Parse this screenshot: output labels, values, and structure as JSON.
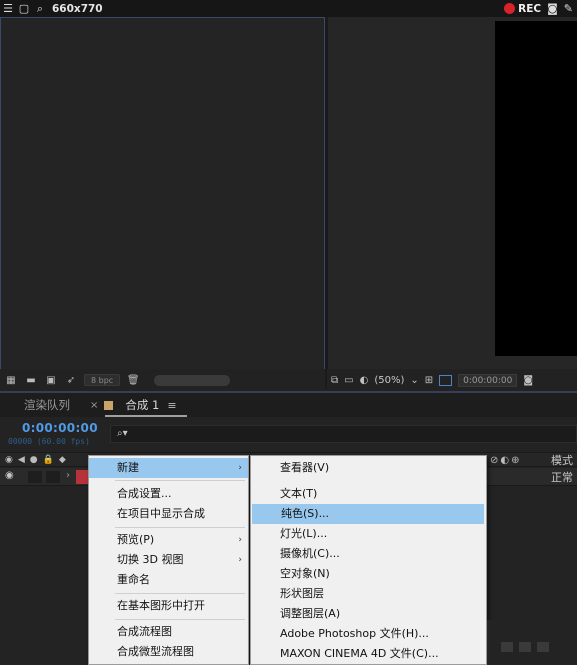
{
  "recorder": {
    "size_label": "660x770",
    "rec_label": "REC"
  },
  "viewer_left": {
    "bpc_label": "8 bpc"
  },
  "viewer_right": {
    "zoom_label": "(50%)",
    "timecode": "0:00:00:00"
  },
  "timeline": {
    "tab_render_queue": "渲染队列",
    "tab_close": "×",
    "tab_comp": "合成 1",
    "tab_menu": "≡",
    "timecode": "0:00:00:00",
    "fps_label": "00000 (60.00 fps)",
    "search_icon_glyph": "⌕▾",
    "header_mode": "模式",
    "layer_mode": "正常"
  },
  "context_menu": {
    "items": [
      {
        "label": "新建",
        "has_submenu": true,
        "highlighted": true
      },
      {
        "label": "合成设置..."
      },
      {
        "label": "在项目中显示合成"
      },
      {
        "label": "预览(P)",
        "has_submenu": true
      },
      {
        "label": "切换 3D 视图",
        "has_submenu": true
      },
      {
        "label": "重命名"
      },
      {
        "label": "在基本图形中打开"
      },
      {
        "label": "合成流程图"
      },
      {
        "label": "合成微型流程图"
      }
    ],
    "submenu_arrow": "›"
  },
  "submenu": {
    "items": [
      {
        "label": "查看器(V)"
      },
      {
        "label": "文本(T)"
      },
      {
        "label": "纯色(S)...",
        "highlighted": true
      },
      {
        "label": "灯光(L)..."
      },
      {
        "label": "摄像机(C)..."
      },
      {
        "label": "空对象(N)"
      },
      {
        "label": "形状图层"
      },
      {
        "label": "调整图层(A)"
      },
      {
        "label": "Adobe Photoshop 文件(H)..."
      },
      {
        "label": "MAXON CINEMA 4D 文件(C)..."
      }
    ]
  },
  "colors": {
    "accent_blue": "#4f9ae6",
    "highlight": "#99c8ef",
    "rec_red": "#d8232a",
    "layer_red": "#b8323b",
    "tab_swatch": "#c9a56a"
  }
}
